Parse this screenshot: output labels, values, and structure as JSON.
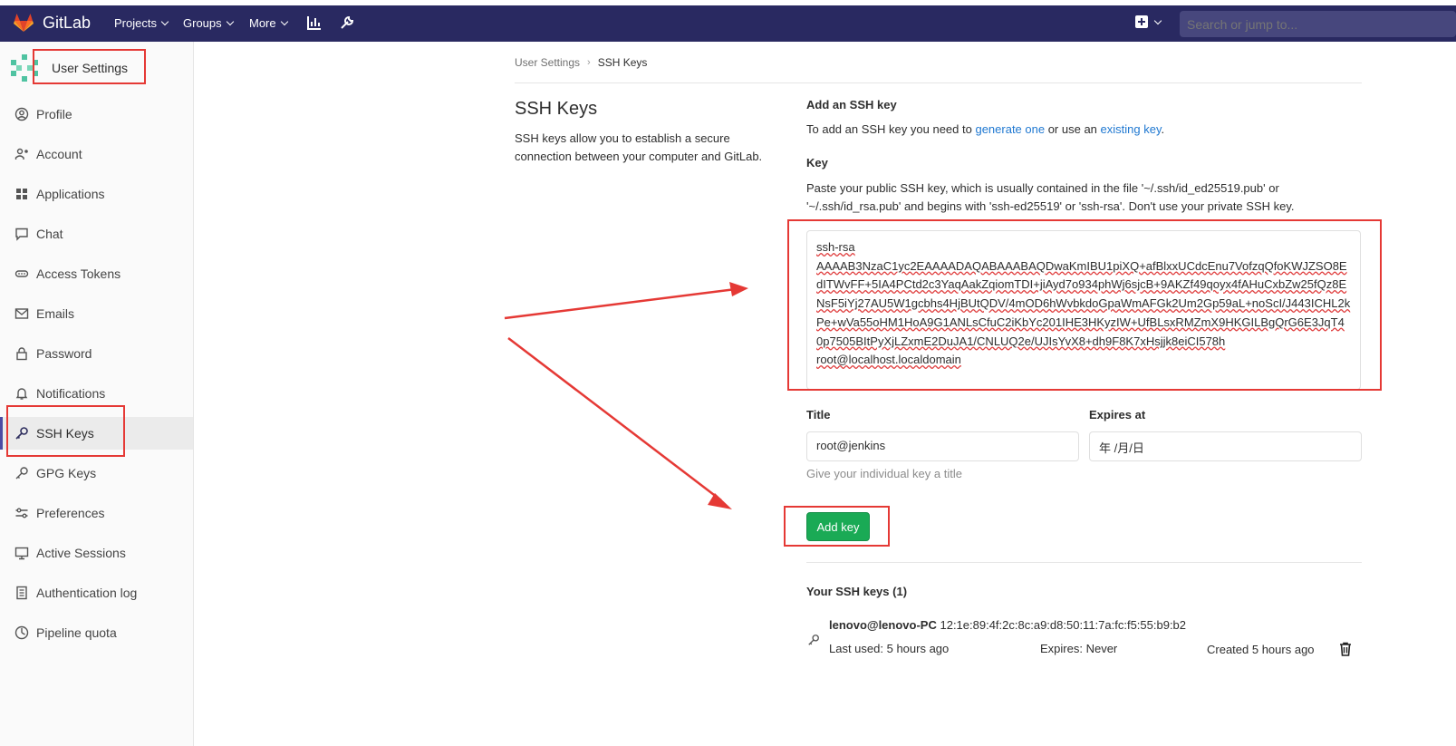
{
  "nav": {
    "brand": "GitLab",
    "projects": "Projects",
    "groups": "Groups",
    "more": "More",
    "search_placeholder": "Search or jump to..."
  },
  "sidebar": {
    "title": "User Settings",
    "items": [
      {
        "label": "Profile",
        "icon": "profile-icon"
      },
      {
        "label": "Account",
        "icon": "account-icon"
      },
      {
        "label": "Applications",
        "icon": "applications-icon"
      },
      {
        "label": "Chat",
        "icon": "chat-icon"
      },
      {
        "label": "Access Tokens",
        "icon": "token-icon"
      },
      {
        "label": "Emails",
        "icon": "mail-icon"
      },
      {
        "label": "Password",
        "icon": "lock-icon"
      },
      {
        "label": "Notifications",
        "icon": "bell-icon"
      },
      {
        "label": "SSH Keys",
        "icon": "key-icon",
        "active": true
      },
      {
        "label": "GPG Keys",
        "icon": "key-icon"
      },
      {
        "label": "Preferences",
        "icon": "preferences-icon"
      },
      {
        "label": "Active Sessions",
        "icon": "monitor-icon"
      },
      {
        "label": "Authentication log",
        "icon": "log-icon"
      },
      {
        "label": "Pipeline quota",
        "icon": "quota-icon"
      }
    ]
  },
  "breadcrumb": {
    "parent": "User Settings",
    "current": "SSH Keys"
  },
  "section": {
    "title": "SSH Keys",
    "description": "SSH keys allow you to establish a secure connection between your computer and GitLab."
  },
  "form": {
    "heading": "Add an SSH key",
    "intro_prefix": "To add an SSH key you need to ",
    "intro_link1": "generate one",
    "intro_middle": " or use an ",
    "intro_link2": "existing key",
    "intro_suffix": ".",
    "key_label": "Key",
    "key_help": "Paste your public SSH key, which is usually contained in the file '~/.ssh/id_ed25519.pub' or '~/.ssh/id_rsa.pub' and begins with 'ssh-ed25519' or 'ssh-rsa'. Don't use your private SSH key.",
    "key_value": "ssh-rsa\nAAAAB3NzaC1yc2EAAAADAQABAAABAQDwaKmIBU1piXQ+afBlxxUCdcEnu7VofzqQfoKWJZSO8EdITWvFF+5IA4PCtd2c3YaqAakZqiomTDI+jiAyd7o934phWj6sjcB+9AKZf49qoyx4fAHuCxbZw25fQz8ENsF5iYj27AU5W1gcbhs4HjBUtQDV/4mOD6hWvbkdoGpaWmAFGk2Um2Gp59aL+noScI/J443ICHL2kPe+wVa55oHM1HoA9G1ANLsCfuC2iKbYc201IHE3HKyzIW+UfBLsxRMZmX9HKGILBgQrG6E3JqT40p7505BItPyXjLZxmE2DuJA1/CNLUQ2e/UJIsYvX8+dh9F8K7xHsjjk8eiCI578h\nroot@localhost.localdomain",
    "title_label": "Title",
    "title_value": "root@jenkins",
    "expires_label": "Expires at",
    "expires_value": "年 /月/日",
    "title_hint": "Give your individual key a title",
    "add_button": "Add key"
  },
  "keys": {
    "heading": "Your SSH keys (1)",
    "items": [
      {
        "name": "lenovo@lenovo-PC",
        "fingerprint": "12:1e:89:4f:2c:8c:a9:d8:50:11:7a:fc:f5:55:b9:b2",
        "last_used": "Last used: 5 hours ago",
        "expires": "Expires: Never",
        "created": "Created 5 hours ago"
      }
    ]
  },
  "colors": {
    "navbar": "#292961",
    "accent_green": "#1aaa55",
    "link": "#1f78d1",
    "annotation_red": "#e53935"
  }
}
